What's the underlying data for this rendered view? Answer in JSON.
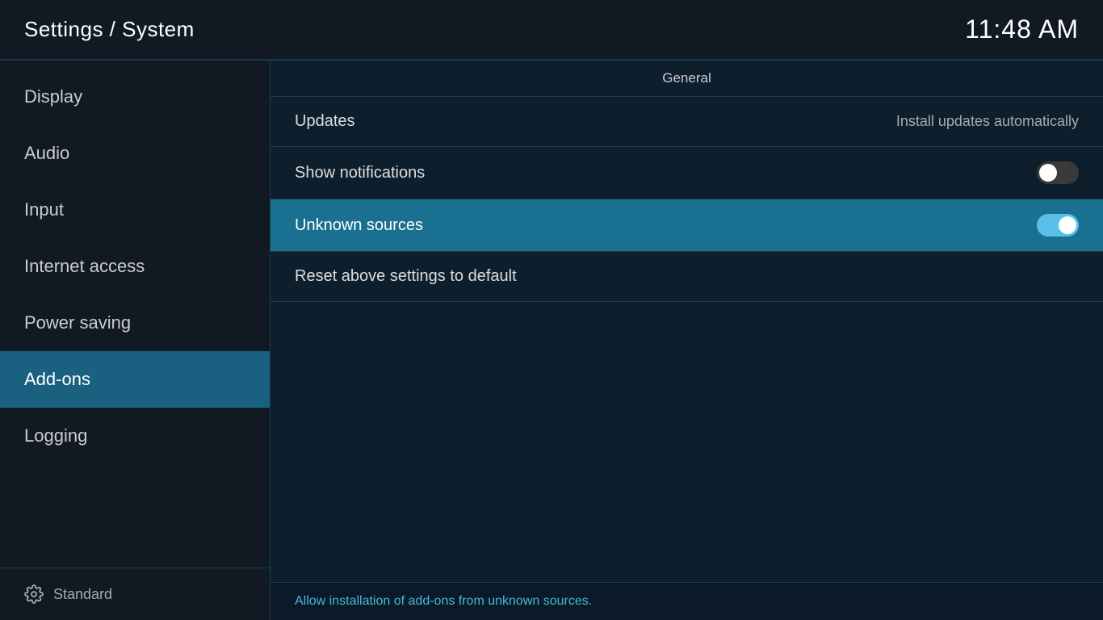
{
  "header": {
    "title": "Settings / System",
    "time": "11:48 AM"
  },
  "sidebar": {
    "items": [
      {
        "id": "display",
        "label": "Display",
        "active": false
      },
      {
        "id": "audio",
        "label": "Audio",
        "active": false
      },
      {
        "id": "input",
        "label": "Input",
        "active": false
      },
      {
        "id": "internet-access",
        "label": "Internet access",
        "active": false
      },
      {
        "id": "power-saving",
        "label": "Power saving",
        "active": false
      },
      {
        "id": "add-ons",
        "label": "Add-ons",
        "active": true
      },
      {
        "id": "logging",
        "label": "Logging",
        "active": false
      }
    ],
    "footer": {
      "label": "Standard",
      "icon": "gear"
    }
  },
  "content": {
    "section": {
      "title": "General"
    },
    "settings": [
      {
        "id": "updates",
        "label": "Updates",
        "type": "value",
        "value": "Install updates automatically",
        "highlighted": false
      },
      {
        "id": "show-notifications",
        "label": "Show notifications",
        "type": "toggle",
        "toggle_state": "off",
        "highlighted": false
      },
      {
        "id": "unknown-sources",
        "label": "Unknown sources",
        "type": "toggle",
        "toggle_state": "on",
        "highlighted": true
      },
      {
        "id": "reset-settings",
        "label": "Reset above settings to default",
        "type": "none",
        "highlighted": false
      }
    ],
    "status": {
      "text": "Allow installation of add-ons from unknown sources."
    }
  }
}
